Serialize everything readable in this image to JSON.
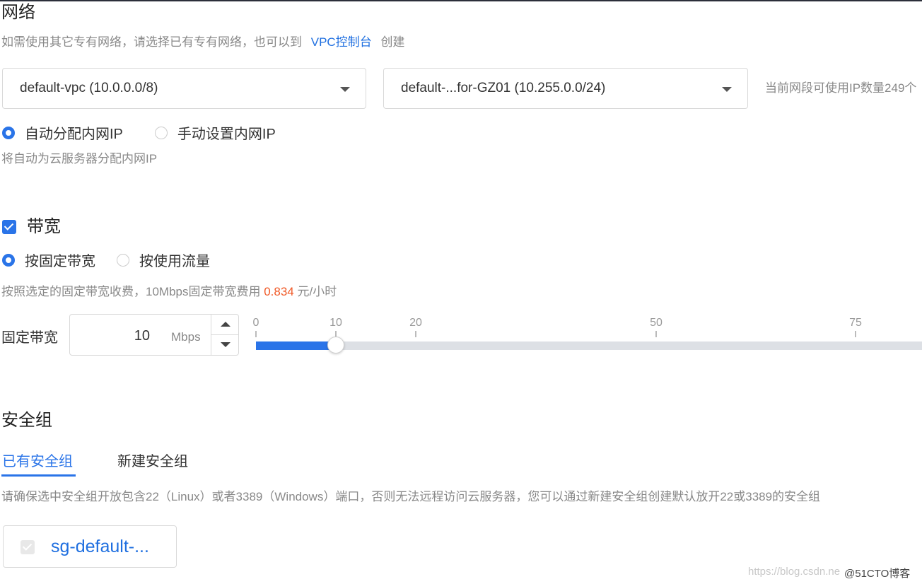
{
  "network": {
    "title": "网络",
    "hint_prefix": "如需使用其它专有网络，请选择已有专有网络，也可以到",
    "hint_link": "VPC控制台",
    "hint_suffix": "创建",
    "vpc_select_value": "default-vpc (10.0.0.0/8)",
    "subnet_select_value": "default-...for-GZ01 (10.255.0.0/24)",
    "ip_available_text": "当前网段可使用IP数量249个",
    "ip_mode_options": [
      {
        "label": "自动分配内网IP",
        "selected": true
      },
      {
        "label": "手动设置内网IP",
        "selected": false
      }
    ],
    "ip_mode_hint": "将自动为云服务器分配内网IP"
  },
  "bandwidth": {
    "enabled": true,
    "title": "带宽",
    "billing_options": [
      {
        "label": "按固定带宽",
        "selected": true
      },
      {
        "label": "按使用流量",
        "selected": false
      }
    ],
    "hint_prefix": "按照选定的固定带宽收费，10Mbps固定带宽费用",
    "price": "0.834",
    "hint_suffix": "元/小时",
    "field_label": "固定带宽",
    "value": "10",
    "unit": "Mbps",
    "slider_value": 10,
    "slider_marks": [
      "0",
      "10",
      "20",
      "50",
      "75"
    ]
  },
  "security_group": {
    "title": "安全组",
    "tabs": [
      {
        "label": "已有安全组",
        "active": true
      },
      {
        "label": "新建安全组",
        "active": false
      }
    ],
    "hint": "请确保选中安全组开放包含22（Linux）或者3389（Windows）端口，否则无法远程访问云服务器，您可以通过新建安全组创建默认放开22或3389的安全组",
    "selected_group": "sg-default-..."
  },
  "watermark": {
    "url_text": "https://blog.csdn.ne",
    "brand_text": "@51CTO博客"
  },
  "colors": {
    "accent": "#2a74e8",
    "link": "#1f6fe0",
    "price": "#f05a28",
    "hint": "#888888"
  }
}
